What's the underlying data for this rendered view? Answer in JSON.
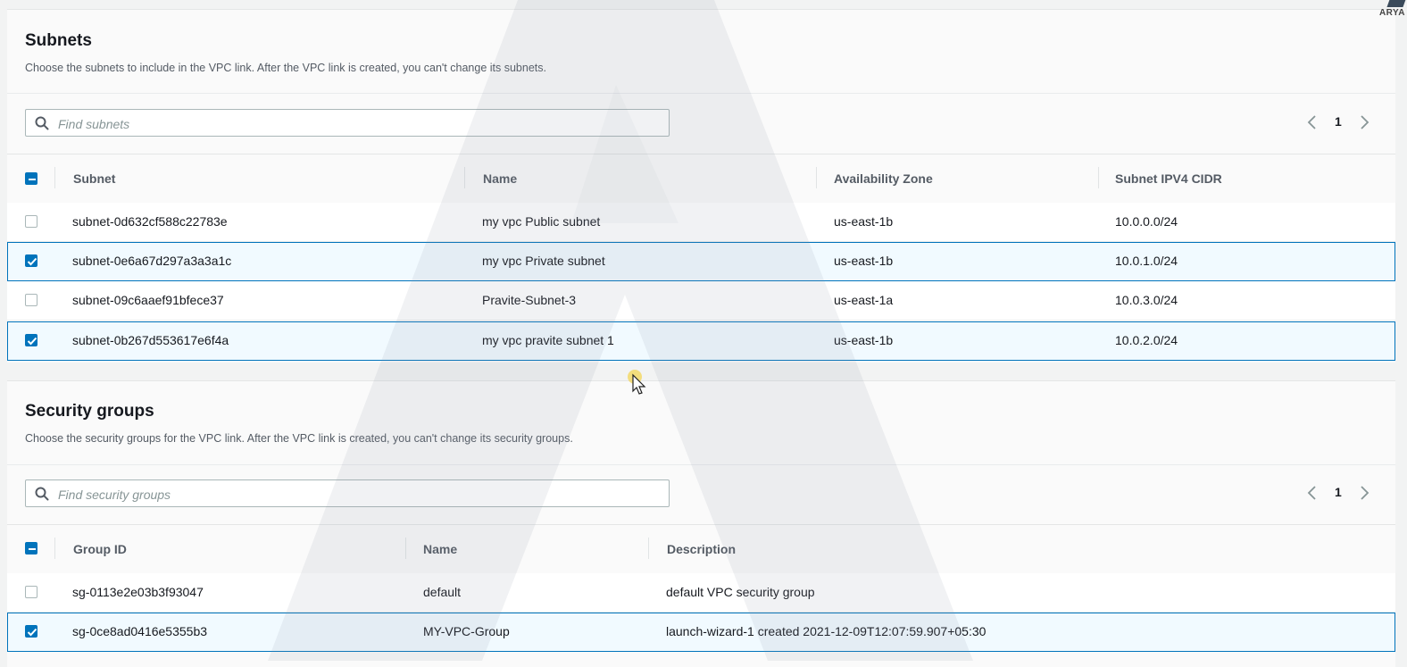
{
  "subnets": {
    "title": "Subnets",
    "description": "Choose the subnets to include in the VPC link. After the VPC link is created, you can't change its subnets.",
    "search_placeholder": "Find subnets",
    "page": "1",
    "columns": [
      "Subnet",
      "Name",
      "Availability Zone",
      "Subnet IPV4 CIDR"
    ],
    "rows": [
      {
        "subnet": "subnet-0d632cf588c22783e",
        "name": "my vpc Public subnet",
        "az": "us-east-1b",
        "cidr": "10.0.0.0/24",
        "checked": false
      },
      {
        "subnet": "subnet-0e6a67d297a3a3a1c",
        "name": "my vpc Private subnet",
        "az": "us-east-1b",
        "cidr": "10.0.1.0/24",
        "checked": true
      },
      {
        "subnet": "subnet-09c6aaef91bfece37",
        "name": "Pravite-Subnet-3",
        "az": "us-east-1a",
        "cidr": "10.0.3.0/24",
        "checked": false
      },
      {
        "subnet": "subnet-0b267d553617e6f4a",
        "name": "my vpc pravite subnet 1",
        "az": "us-east-1b",
        "cidr": "10.0.2.0/24",
        "checked": true
      }
    ]
  },
  "security_groups": {
    "title": "Security groups",
    "description": "Choose the security groups for the VPC link. After the VPC link is created, you can't change its security groups.",
    "search_placeholder": "Find security groups",
    "page": "1",
    "columns": [
      "Group ID",
      "Name",
      "Description"
    ],
    "rows": [
      {
        "group_id": "sg-0113e2e03b3f93047",
        "name": "default",
        "description": "default VPC security group",
        "checked": false
      },
      {
        "group_id": "sg-0ce8ad0416e5355b3",
        "name": "MY-VPC-Group",
        "description": "launch-wizard-1 created 2021-12-09T12:07:59.907+05:30",
        "checked": true
      }
    ]
  },
  "watermark": {
    "corner_text": "ARYA"
  },
  "colors": {
    "accent": "#0073bb",
    "selected_bg": "#f1faff",
    "page_bg": "#f2f3f3"
  },
  "icons": {
    "search": "search-icon",
    "prev": "chevron-left-icon",
    "next": "chevron-right-icon",
    "check": "checkmark-icon"
  }
}
